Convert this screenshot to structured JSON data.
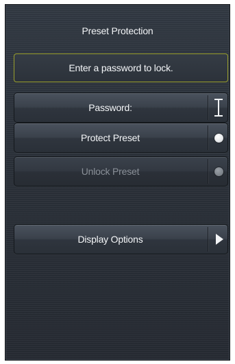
{
  "panel": {
    "title": "Preset Protection"
  },
  "notice": {
    "text": "Enter a password to lock."
  },
  "buttons": {
    "password": {
      "label": "Password:",
      "icon": "text-cursor-icon"
    },
    "protect": {
      "label": "Protect Preset",
      "icon": "radio-dot-icon",
      "enabled": true
    },
    "unlock": {
      "label": "Unlock Preset",
      "icon": "radio-dot-icon",
      "enabled": false
    },
    "display_options": {
      "label": "Display Options",
      "icon": "chevron-right-icon"
    }
  },
  "colors": {
    "panel_background": "#2a3038",
    "notice_border": "#9aa02c",
    "text": "#f4f6f8",
    "disabled_text": "#8a9098"
  }
}
